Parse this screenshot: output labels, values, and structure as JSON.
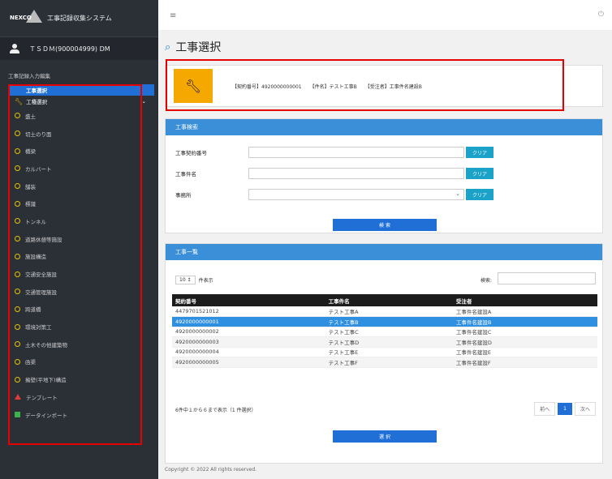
{
  "app": {
    "logo_text": "NEXCO",
    "title": "工事記録収集システム",
    "user": "ＴＳＤＭ(900004999) DM"
  },
  "sidebar": {
    "section_title": "工事記録入力編集",
    "active_item": "工事選択",
    "parent_item": "工種選択",
    "items": [
      "盛土",
      "切土のり面",
      "橋梁",
      "カルバート",
      "舗装",
      "標識",
      "トンネル",
      "道路休憩等施設",
      "施設構造",
      "交通安全施設",
      "交通管理施設",
      "跨道橋",
      "環境対策工",
      "土木その他建築物",
      "函渠",
      "擁壁(平地下)構造"
    ],
    "extra_items": [
      {
        "label": "テンプレート",
        "icon": "warning-icon"
      },
      {
        "label": "データインポート",
        "icon": "import-icon"
      }
    ]
  },
  "page": {
    "title": "工事選択"
  },
  "selected_info": {
    "contract_no": "【契約番号】4920000000001",
    "name": "【件名】テストエ事B",
    "contractor": "【受注者】工事件名建設B"
  },
  "search": {
    "header": "工事検索",
    "contract_label": "工事契約番号",
    "name_label": "工事件名",
    "office_label": "事務所",
    "clear_label": "クリア",
    "search_button": "検 索"
  },
  "list": {
    "header": "工事一覧",
    "page_len": "10",
    "page_len_label": "件表示",
    "search_label": "検索:",
    "columns": [
      "契約番号",
      "工事件名",
      "受注者"
    ],
    "rows": [
      [
        "4479701521012",
        "テスト工事A",
        "工事件名建設A"
      ],
      [
        "4920000000001",
        "テスト工事B",
        "工事件名建設B"
      ],
      [
        "4920000000002",
        "テスト工事C",
        "工事件名建設C"
      ],
      [
        "4920000000003",
        "テスト工事D",
        "工事件名建設D"
      ],
      [
        "4920000000004",
        "テスト工事E",
        "工事件名建設E"
      ],
      [
        "4920000000005",
        "テスト工事F",
        "工事件名建設F"
      ]
    ],
    "info": "6件中１から６まで表示（1 件選択）",
    "prev": "前へ",
    "page": "1",
    "next": "次へ",
    "select_button": "選 択"
  },
  "footer": "Copyright © 2022 All rights reserved.",
  "colors": {
    "sidebar_bg": "#2b3037",
    "accent": "#1f6fd6",
    "panel_header": "#3a8fd8",
    "highlight_box": "#e60000",
    "wrench_bg": "#f5a800"
  }
}
